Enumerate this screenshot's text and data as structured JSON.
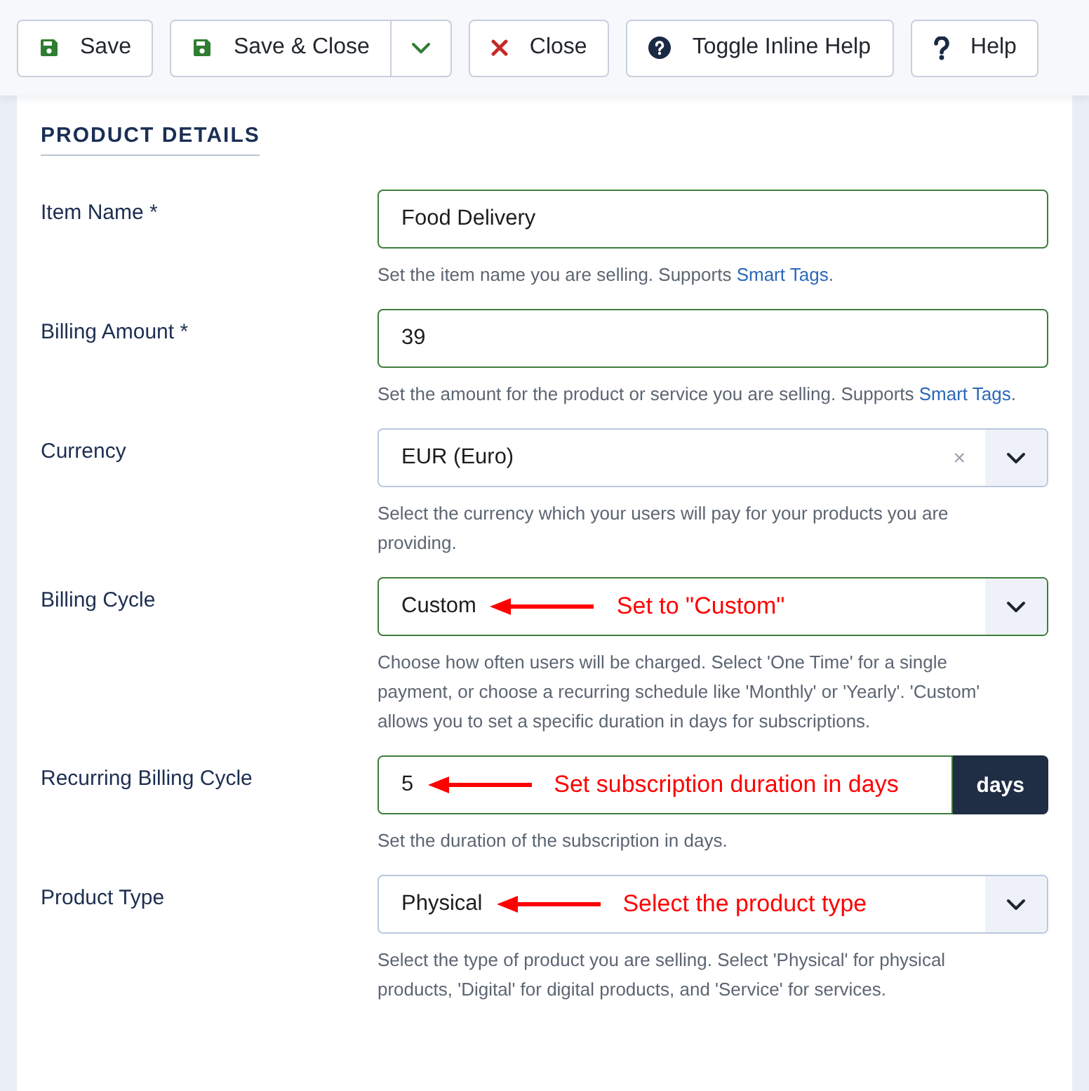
{
  "toolbar": {
    "buttons": [
      {
        "label": "Save",
        "kind": "save"
      },
      {
        "label": "Save & Close",
        "kind": "save-split"
      },
      {
        "label": "Close",
        "kind": "close"
      },
      {
        "label": "Toggle Inline Help",
        "kind": "inline-help"
      },
      {
        "label": "Help",
        "kind": "help"
      }
    ]
  },
  "section": {
    "title": "PRODUCT DETAILS"
  },
  "fields": [
    {
      "label": "Item Name *",
      "kind": "text",
      "value": "Food Delivery",
      "valid": true,
      "help": [
        {
          "text": "Set the item name you are selling. Supports "
        },
        {
          "link": "Smart Tags"
        },
        {
          "text": "."
        }
      ]
    },
    {
      "label": "Billing Amount *",
      "kind": "text",
      "value": "39",
      "valid": true,
      "help": [
        {
          "text": "Set the amount for the product or service you are selling. Supports "
        },
        {
          "link": "Smart Tags"
        },
        {
          "text": "."
        }
      ]
    },
    {
      "label": "Currency",
      "kind": "select",
      "value": "EUR (Euro)",
      "valid": false,
      "clear": "×",
      "help": [
        {
          "text": "Select the currency which your users will pay for your products you are providing."
        }
      ]
    },
    {
      "label": "Billing Cycle",
      "kind": "select",
      "value": "Custom",
      "valid": true,
      "annotation": "Set to \"Custom\"",
      "help": [
        {
          "text": "Choose how often users will be charged. Select 'One Time' for a single payment, or choose a recurring schedule like 'Monthly' or 'Yearly'. 'Custom' allows you to set a specific duration in days for subscriptions."
        }
      ]
    },
    {
      "label": "Recurring Billing Cycle",
      "kind": "addon",
      "value": "5",
      "valid": true,
      "addon": "days",
      "annotation": "Set subscription duration in days",
      "help": [
        {
          "text": "Set the duration of the subscription in days."
        }
      ]
    },
    {
      "label": "Product Type",
      "kind": "select",
      "value": "Physical",
      "valid": false,
      "annotation": "Select the product type",
      "help": [
        {
          "text": "Select the type of product you are selling. Select 'Physical' for physical products, 'Digital' for digital products, and 'Service' for services."
        }
      ]
    }
  ]
}
